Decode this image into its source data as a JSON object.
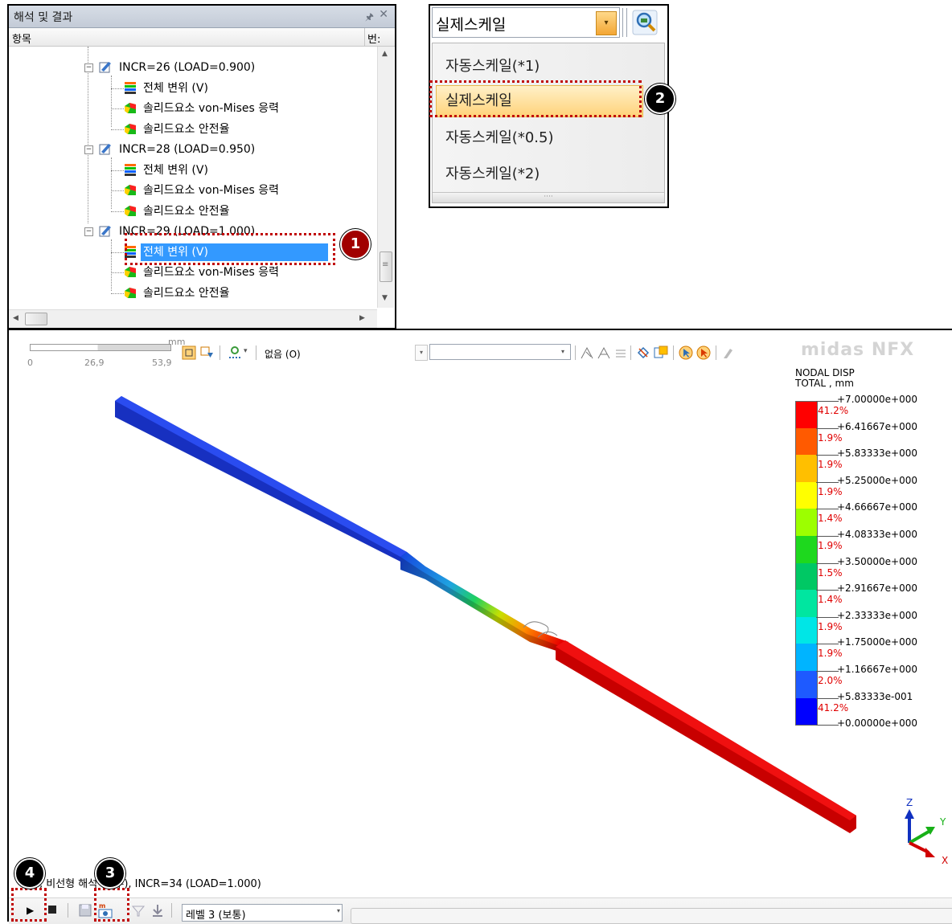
{
  "tree_panel": {
    "title": "해석 및 결과",
    "pin_icon": "pin-icon",
    "close_icon": "close-icon",
    "col_item": "항목",
    "col_num": "번:",
    "groups": [
      {
        "label": "INCR=26 (LOAD=0.900)",
        "children": [
          "전체 변위 (V)",
          "솔리드요소 von-Mises 응력",
          "솔리드요소 안전율"
        ]
      },
      {
        "label": "INCR=28 (LOAD=0.950)",
        "children": [
          "전체 변위 (V)",
          "솔리드요소 von-Mises 응력",
          "솔리드요소 안전율"
        ]
      },
      {
        "label": "INCR=29 (LOAD=1.000)",
        "children": [
          "전체 변위 (V)",
          "솔리드요소 von-Mises 응력",
          "솔리드요소 안전율"
        ]
      }
    ],
    "expand_symbol": "−",
    "scroll_up": "▲",
    "scroll_down": "▼",
    "scroll_left": "◀",
    "scroll_right": "▶",
    "scroll_grip": "≡"
  },
  "scale_panel": {
    "current": "실제스케일",
    "arrow": "▾",
    "options": [
      "자동스케일(*1)",
      "실제스케일",
      "자동스케일(*0.5)",
      "자동스케일(*2)"
    ],
    "grip": "····",
    "zoom_icon": "magnifier-icon"
  },
  "viewport": {
    "ruler_unit": "mm",
    "ruler_ticks": [
      "0",
      "26,9",
      "53,9"
    ],
    "toolbar_none_label": "없음 (O)",
    "combo_arrow": "▾",
    "logo": "midas NFX",
    "legend": {
      "title_line1": "NODAL DISP",
      "title_line2": "TOTAL , mm",
      "values": [
        "+7.00000e+000",
        "+6.41667e+000",
        "+5.83333e+000",
        "+5.25000e+000",
        "+4.66667e+000",
        "+4.08333e+000",
        "+3.50000e+000",
        "+2.91667e+000",
        "+2.33333e+000",
        "+1.75000e+000",
        "+1.16667e+000",
        "+5.83333e-001",
        "+0.00000e+000"
      ],
      "percents": [
        "41.2%",
        "1.9%",
        "1.9%",
        "1.9%",
        "1.4%",
        "1.9%",
        "1.5%",
        "1.4%",
        "1.9%",
        "1.9%",
        "2.0%",
        "41.2%"
      ],
      "colors": [
        "#ff0000",
        "#ff5a00",
        "#ffbf00",
        "#ffff00",
        "#9cff00",
        "#1ed81e",
        "#00c864",
        "#00e6a0",
        "#00e6e6",
        "#00b4ff",
        "#1e5aff",
        "#0000ff"
      ]
    },
    "axis": {
      "z": "Z",
      "y": "Y",
      "x": "X"
    },
    "status": "e,  비선형 해석 (필수),  INCR=34 (LOAD=1.000)",
    "level_select": "레벨 3 (보통)",
    "level_arrow": "▾"
  },
  "annotations": {
    "b1": "1",
    "b2": "2",
    "b3": "3",
    "b4": "4"
  }
}
